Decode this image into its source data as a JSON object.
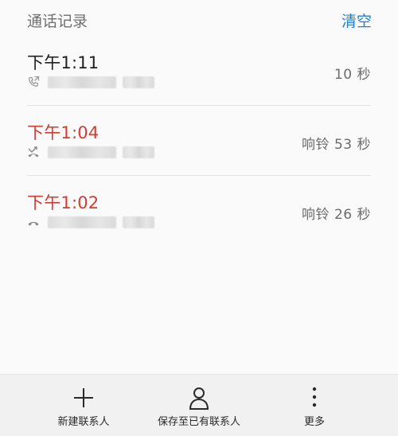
{
  "header": {
    "title": "通话记录",
    "clear_label": "清空"
  },
  "calls": [
    {
      "time": "下午1:11",
      "duration": "10 秒",
      "type": "outgoing"
    },
    {
      "time": "下午1:04",
      "duration": "响铃 53 秒",
      "type": "missed"
    },
    {
      "time": "下午1:02",
      "duration": "响铃 26 秒",
      "type": "rejected"
    }
  ],
  "toolbar": {
    "new_contact": "新建联系人",
    "save_existing": "保存至已有联系人",
    "more": "更多"
  },
  "icons": {
    "outgoing": "outgoing-call-icon",
    "missed": "missed-call-icon",
    "rejected": "rejected-call-icon",
    "new_contact": "plus-icon",
    "save_existing": "person-icon",
    "more": "vertical-dots-icon"
  },
  "colors": {
    "accent": "#1f7fd2",
    "missed": "#d33a32",
    "toolbar_bg": "#f1f1f1"
  }
}
